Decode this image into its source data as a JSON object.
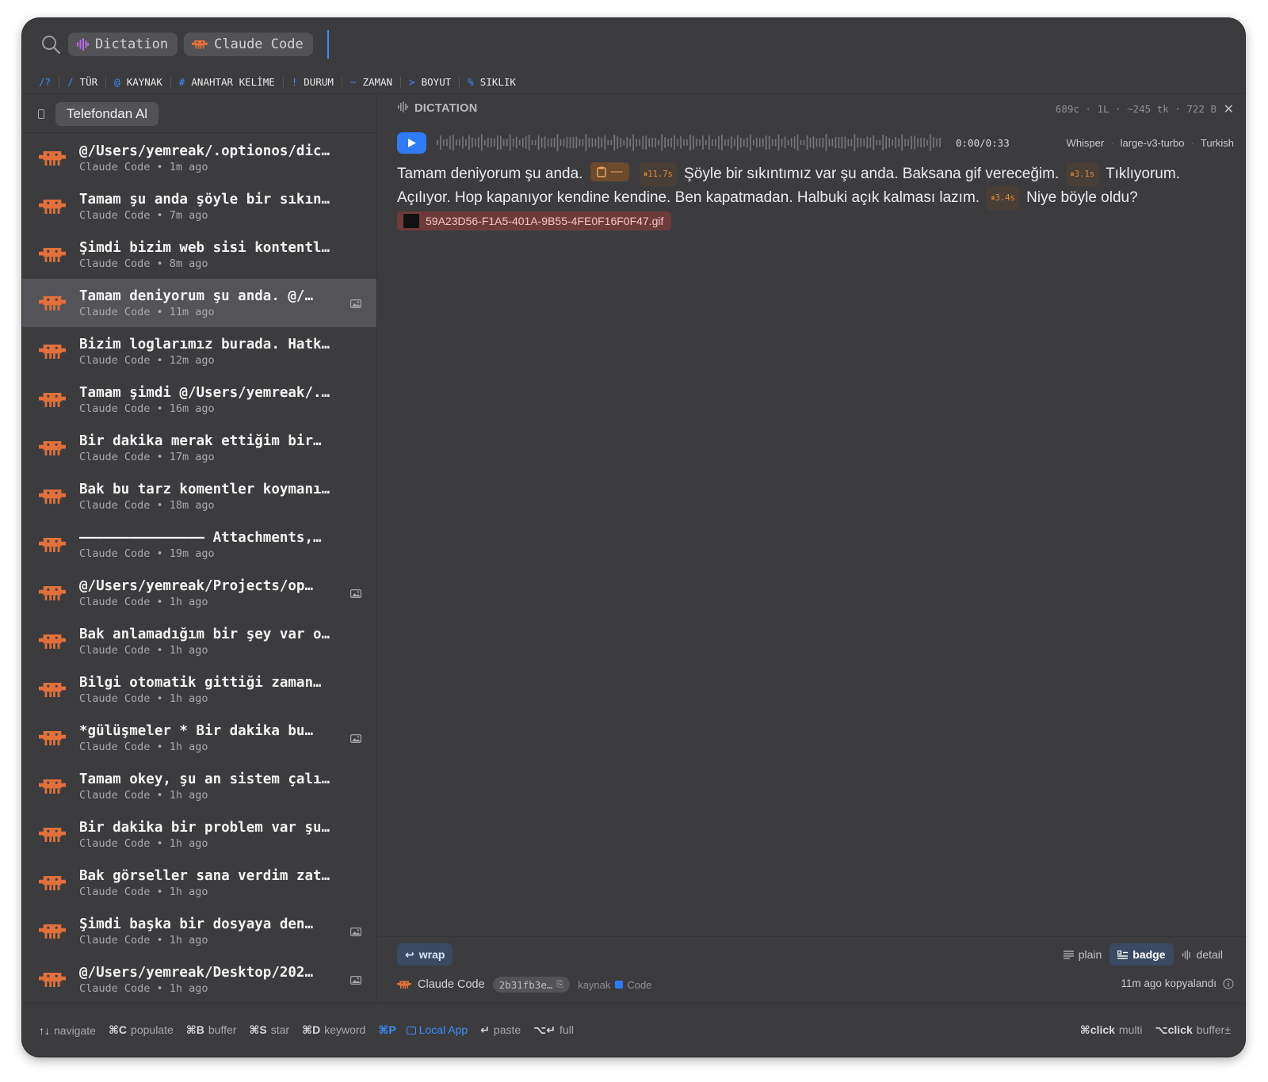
{
  "search": {
    "chips": [
      {
        "label": "Dictation",
        "icon": "waveform-icon"
      },
      {
        "label": "Claude Code",
        "icon": "claude-crab-icon"
      }
    ]
  },
  "filters": [
    {
      "symbol": "/?",
      "label": ""
    },
    {
      "symbol": "/",
      "label": "TÜR"
    },
    {
      "symbol": "@",
      "label": "KAYNAK"
    },
    {
      "symbol": "#",
      "label": "ANAHTAR KELİME"
    },
    {
      "symbol": "!",
      "label": "DURUM"
    },
    {
      "symbol": "~",
      "label": "ZAMAN"
    },
    {
      "symbol": ">",
      "label": "BOYUT"
    },
    {
      "symbol": "%",
      "label": "SIKLIK"
    }
  ],
  "left": {
    "phone_button": "Telefondan Al",
    "items": [
      {
        "title": "@/Users/yemreak/.optionos/dic…",
        "meta": "Claude Code • 1m ago",
        "image": false
      },
      {
        "title": "Tamam şu anda şöyle bir sıkın…",
        "meta": "Claude Code • 7m ago",
        "image": false
      },
      {
        "title": "Şimdi bizim web sisi kontentl…",
        "meta": "Claude Code • 8m ago",
        "image": false
      },
      {
        "title": "Tamam deniyorum şu anda. @/…",
        "meta": "Claude Code • 11m ago",
        "image": true,
        "selected": true
      },
      {
        "title": "Bizim loglarımız burada. Hatk…",
        "meta": "Claude Code • 12m ago",
        "image": false
      },
      {
        "title": "Tamam şimdi @/Users/yemreak/.…",
        "meta": "Claude Code • 16m ago",
        "image": false
      },
      {
        "title": "Bir dakika merak ettiğim bir…",
        "meta": "Claude Code • 17m ago",
        "image": false
      },
      {
        "title": "Bak bu tarz komentler koymanı…",
        "meta": "Claude Code • 18m ago",
        "image": false
      },
      {
        "title": "——————————————— Attachments,…",
        "meta": "Claude Code • 19m ago",
        "image": false
      },
      {
        "title": "@/Users/yemreak/Projects/op…",
        "meta": "Claude Code • 1h ago",
        "image": true
      },
      {
        "title": "Bak anlamadığım bir şey var o…",
        "meta": "Claude Code • 1h ago",
        "image": false
      },
      {
        "title": "Bilgi otomatik gittiği zaman…",
        "meta": "Claude Code • 1h ago",
        "image": false
      },
      {
        "title": "*gülüşmeler * Bir dakika bu…",
        "meta": "Claude Code • 1h ago",
        "image": true
      },
      {
        "title": "Tamam okey, şu an sistem çalı…",
        "meta": "Claude Code • 1h ago",
        "image": false
      },
      {
        "title": "Bir dakika bir problem var şu…",
        "meta": "Claude Code • 1h ago",
        "image": false
      },
      {
        "title": "Bak görseller sana verdim zat…",
        "meta": "Claude Code • 1h ago",
        "image": false
      },
      {
        "title": "Şimdi başka bir dosyaya den…",
        "meta": "Claude Code • 1h ago",
        "image": true
      },
      {
        "title": "@/Users/yemreak/Desktop/202…",
        "meta": "Claude Code • 1h ago",
        "image": true
      }
    ]
  },
  "detail": {
    "type_label": "DICTATION",
    "stats": "689c · 1L · ~245 tk · 722 B",
    "time": "0:00/0:33",
    "engine": "Whisper",
    "model": "large-v3-turbo",
    "language": "Turkish",
    "transcript": {
      "p1": "Tamam deniyorum şu anda.",
      "clip_badge": "—",
      "pause1": "11.7s",
      "p2": "Şöyle bir sıkıntımız var şu anda. Baksana gif vereceğim.",
      "pause2": "3.1s",
      "p3": "Tıklıyorum. Açılıyor. Hop kapanıyor kendine kendine. Ben kapatmadan. Halbuki açık kalması lazım.",
      "pause3": "3.4s",
      "p4": "Niye böyle oldu?",
      "attachment": "59A23D56-F1A5-401A-9B55-4FE0F16F0F47.gif"
    },
    "wrap": "wrap",
    "modes": {
      "plain": "plain",
      "badge": "badge",
      "detail": "detail",
      "active": "badge"
    },
    "source": "Claude Code",
    "hash": "2b31fb3e…",
    "kaynak_label": "kaynak",
    "code_label": "Code",
    "copied": "11m ago kopyalandı"
  },
  "bottom": {
    "hints": [
      {
        "key": "↑↓",
        "label": "navigate"
      },
      {
        "key": "⌘C",
        "label": "populate"
      },
      {
        "key": "⌘B",
        "label": "buffer"
      },
      {
        "key": "⌘S",
        "label": "star"
      },
      {
        "key": "⌘D",
        "label": "keyword"
      }
    ],
    "local_app": {
      "key": "⌘P",
      "label": "Local App"
    },
    "hints2": [
      {
        "key": "↵",
        "label": "paste"
      },
      {
        "key": "⌥↵",
        "label": "full"
      }
    ],
    "right_hints": [
      {
        "key": "⌘click",
        "label": "multi"
      },
      {
        "key": "⌥click",
        "label": "buffer±"
      }
    ]
  },
  "colors": {
    "accent": "#3b8dff",
    "claude": "#e2703a",
    "background": "#3c3c3f"
  }
}
